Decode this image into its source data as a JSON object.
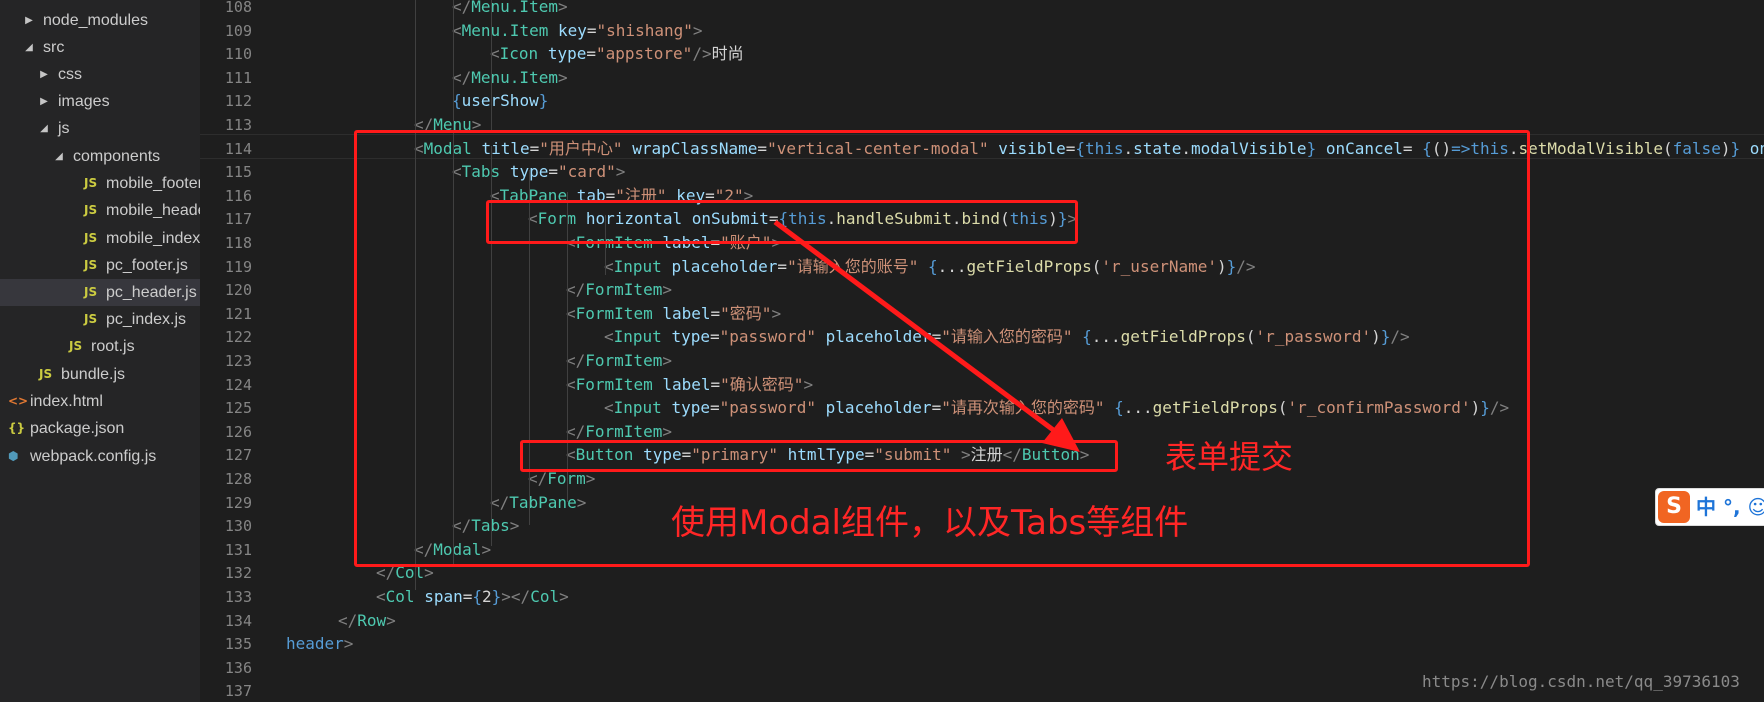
{
  "explorer": {
    "items": [
      {
        "label": "node_modules",
        "type": "folder",
        "expanded": false
      },
      {
        "label": "src",
        "type": "folder",
        "expanded": true
      },
      {
        "label": "css",
        "type": "folder",
        "expanded": false
      },
      {
        "label": "images",
        "type": "folder",
        "expanded": false
      },
      {
        "label": "js",
        "type": "folder",
        "expanded": true
      },
      {
        "label": "components",
        "type": "folder",
        "expanded": true
      },
      {
        "label": "mobile_footer.js",
        "type": "js",
        "icon": "JS"
      },
      {
        "label": "mobile_header.js",
        "type": "js",
        "icon": "JS"
      },
      {
        "label": "mobile_index.js",
        "type": "js",
        "icon": "JS"
      },
      {
        "label": "pc_footer.js",
        "type": "js",
        "icon": "JS"
      },
      {
        "label": "pc_header.js",
        "type": "js",
        "icon": "JS",
        "selected": true
      },
      {
        "label": "pc_index.js",
        "type": "js",
        "icon": "JS"
      },
      {
        "label": "root.js",
        "type": "js",
        "icon": "JS"
      },
      {
        "label": "bundle.js",
        "type": "js",
        "icon": "JS"
      },
      {
        "label": "index.html",
        "type": "html",
        "icon": "<>"
      },
      {
        "label": "package.json",
        "type": "json",
        "icon": "{}"
      },
      {
        "label": "webpack.config.js",
        "type": "config",
        "icon": "⬢"
      }
    ]
  },
  "editor": {
    "line_numbers": [
      "108",
      "109",
      "110",
      "111",
      "112",
      "113",
      "114",
      "115",
      "116",
      "117",
      "118",
      "119",
      "120",
      "121",
      "122",
      "123",
      "124",
      "125",
      "126",
      "127",
      "128",
      "129",
      "130",
      "131",
      "132",
      "133",
      "134",
      "135",
      "136",
      "137"
    ],
    "lines": [
      {
        "tokens": [
          {
            "c": "tb",
            "t": "</"
          },
          {
            "c": "tn",
            "t": "Menu.Item"
          },
          {
            "c": "tb",
            "t": ">"
          }
        ]
      },
      {
        "tokens": [
          {
            "c": "tb",
            "t": "<"
          },
          {
            "c": "tn",
            "t": "Menu.Item"
          },
          {
            "c": "tx",
            "t": " "
          },
          {
            "c": "at",
            "t": "key"
          },
          {
            "c": "tx",
            "t": "="
          },
          {
            "c": "st",
            "t": "\"shishang\""
          },
          {
            "c": "tb",
            "t": ">"
          }
        ]
      },
      {
        "tokens": [
          {
            "c": "tb",
            "t": "<"
          },
          {
            "c": "tn",
            "t": "Icon"
          },
          {
            "c": "tx",
            "t": " "
          },
          {
            "c": "at",
            "t": "type"
          },
          {
            "c": "tx",
            "t": "="
          },
          {
            "c": "st",
            "t": "\"appstore\""
          },
          {
            "c": "tb",
            "t": "/>"
          },
          {
            "c": "tx",
            "t": "时尚"
          }
        ]
      },
      {
        "tokens": [
          {
            "c": "tb",
            "t": "</"
          },
          {
            "c": "tn",
            "t": "Menu.Item"
          },
          {
            "c": "tb",
            "t": ">"
          }
        ]
      },
      {
        "tokens": [
          {
            "c": "kw",
            "t": "{"
          },
          {
            "c": "at",
            "t": "userShow"
          },
          {
            "c": "kw",
            "t": "}"
          }
        ]
      },
      {
        "tokens": [
          {
            "c": "tb",
            "t": "</"
          },
          {
            "c": "tn",
            "t": "Menu"
          },
          {
            "c": "tb",
            "t": ">"
          }
        ]
      },
      {
        "tokens": [
          {
            "c": "tb",
            "t": "<"
          },
          {
            "c": "tn",
            "t": "Modal"
          },
          {
            "c": "tx",
            "t": " "
          },
          {
            "c": "at",
            "t": "title"
          },
          {
            "c": "tx",
            "t": "="
          },
          {
            "c": "st",
            "t": "\"用户中心\""
          },
          {
            "c": "tx",
            "t": " "
          },
          {
            "c": "at",
            "t": "wrapClassName"
          },
          {
            "c": "tx",
            "t": "="
          },
          {
            "c": "st",
            "t": "\"vertical-center-modal\""
          },
          {
            "c": "tx",
            "t": " "
          },
          {
            "c": "at",
            "t": "visible"
          },
          {
            "c": "tx",
            "t": "="
          },
          {
            "c": "kw",
            "t": "{this"
          },
          {
            "c": "tx",
            "t": "."
          },
          {
            "c": "at",
            "t": "state"
          },
          {
            "c": "tx",
            "t": "."
          },
          {
            "c": "at",
            "t": "modalVisible"
          },
          {
            "c": "kw",
            "t": "}"
          },
          {
            "c": "tx",
            "t": " "
          },
          {
            "c": "at",
            "t": "onCancel"
          },
          {
            "c": "tx",
            "t": "= "
          },
          {
            "c": "kw",
            "t": "{"
          },
          {
            "c": "tx",
            "t": "()"
          },
          {
            "c": "kw",
            "t": "=>this"
          },
          {
            "c": "tx",
            "t": "."
          },
          {
            "c": "fn",
            "t": "setModalVisible"
          },
          {
            "c": "tx",
            "t": "("
          },
          {
            "c": "kw",
            "t": "false"
          },
          {
            "c": "tx",
            "t": ")"
          },
          {
            "c": "kw",
            "t": "}"
          },
          {
            "c": "tx",
            "t": " "
          },
          {
            "c": "at",
            "t": "onOk"
          },
          {
            "c": "tx",
            "t": "="
          }
        ]
      },
      {
        "tokens": [
          {
            "c": "tb",
            "t": "<"
          },
          {
            "c": "tn",
            "t": "Tabs"
          },
          {
            "c": "tx",
            "t": " "
          },
          {
            "c": "at",
            "t": "type"
          },
          {
            "c": "tx",
            "t": "="
          },
          {
            "c": "st",
            "t": "\"card\""
          },
          {
            "c": "tb",
            "t": ">"
          }
        ]
      },
      {
        "tokens": [
          {
            "c": "tb",
            "t": "<"
          },
          {
            "c": "tn",
            "t": "TabPane"
          },
          {
            "c": "tx",
            "t": " "
          },
          {
            "c": "at",
            "t": "tab"
          },
          {
            "c": "tx",
            "t": "="
          },
          {
            "c": "st",
            "t": "\"注册\""
          },
          {
            "c": "tx",
            "t": " "
          },
          {
            "c": "at",
            "t": "key"
          },
          {
            "c": "tx",
            "t": "="
          },
          {
            "c": "st",
            "t": "\"2\""
          },
          {
            "c": "tb",
            "t": ">"
          }
        ]
      },
      {
        "tokens": [
          {
            "c": "tb",
            "t": "<"
          },
          {
            "c": "tn",
            "t": "Form"
          },
          {
            "c": "tx",
            "t": " "
          },
          {
            "c": "at",
            "t": "horizontal"
          },
          {
            "c": "tx",
            "t": " "
          },
          {
            "c": "at",
            "t": "onSubmit"
          },
          {
            "c": "tx",
            "t": "="
          },
          {
            "c": "kw",
            "t": "{this"
          },
          {
            "c": "tx",
            "t": "."
          },
          {
            "c": "fn",
            "t": "handleSubmit"
          },
          {
            "c": "tx",
            "t": "."
          },
          {
            "c": "fn",
            "t": "bind"
          },
          {
            "c": "tx",
            "t": "("
          },
          {
            "c": "kw",
            "t": "this"
          },
          {
            "c": "tx",
            "t": ")"
          },
          {
            "c": "kw",
            "t": "}"
          },
          {
            "c": "tb",
            "t": ">"
          }
        ]
      },
      {
        "tokens": [
          {
            "c": "tb",
            "t": "<"
          },
          {
            "c": "tn",
            "t": "FormItem"
          },
          {
            "c": "tx",
            "t": " "
          },
          {
            "c": "at",
            "t": "label"
          },
          {
            "c": "tx",
            "t": "="
          },
          {
            "c": "st",
            "t": "\"账户\""
          },
          {
            "c": "tb",
            "t": ">"
          }
        ]
      },
      {
        "tokens": [
          {
            "c": "tb",
            "t": "<"
          },
          {
            "c": "tn",
            "t": "Input"
          },
          {
            "c": "tx",
            "t": " "
          },
          {
            "c": "at",
            "t": "placeholder"
          },
          {
            "c": "tx",
            "t": "="
          },
          {
            "c": "st",
            "t": "\"请输入您的账号\""
          },
          {
            "c": "tx",
            "t": " "
          },
          {
            "c": "kw",
            "t": "{"
          },
          {
            "c": "tx",
            "t": "..."
          },
          {
            "c": "fn",
            "t": "getFieldProps"
          },
          {
            "c": "tx",
            "t": "("
          },
          {
            "c": "st",
            "t": "'r_userName'"
          },
          {
            "c": "tx",
            "t": ")"
          },
          {
            "c": "kw",
            "t": "}"
          },
          {
            "c": "tb",
            "t": "/>"
          }
        ]
      },
      {
        "tokens": [
          {
            "c": "tb",
            "t": "</"
          },
          {
            "c": "tn",
            "t": "FormItem"
          },
          {
            "c": "tb",
            "t": ">"
          }
        ]
      },
      {
        "tokens": [
          {
            "c": "tb",
            "t": "<"
          },
          {
            "c": "tn",
            "t": "FormItem"
          },
          {
            "c": "tx",
            "t": " "
          },
          {
            "c": "at",
            "t": "label"
          },
          {
            "c": "tx",
            "t": "="
          },
          {
            "c": "st",
            "t": "\"密码\""
          },
          {
            "c": "tb",
            "t": ">"
          }
        ]
      },
      {
        "tokens": [
          {
            "c": "tb",
            "t": "<"
          },
          {
            "c": "tn",
            "t": "Input"
          },
          {
            "c": "tx",
            "t": " "
          },
          {
            "c": "at",
            "t": "type"
          },
          {
            "c": "tx",
            "t": "="
          },
          {
            "c": "st",
            "t": "\"password\""
          },
          {
            "c": "tx",
            "t": " "
          },
          {
            "c": "at",
            "t": "placeholder"
          },
          {
            "c": "tx",
            "t": "="
          },
          {
            "c": "st",
            "t": "\"请输入您的密码\""
          },
          {
            "c": "tx",
            "t": " "
          },
          {
            "c": "kw",
            "t": "{"
          },
          {
            "c": "tx",
            "t": "..."
          },
          {
            "c": "fn",
            "t": "getFieldProps"
          },
          {
            "c": "tx",
            "t": "("
          },
          {
            "c": "st",
            "t": "'r_password'"
          },
          {
            "c": "tx",
            "t": ")"
          },
          {
            "c": "kw",
            "t": "}"
          },
          {
            "c": "tb",
            "t": "/>"
          }
        ]
      },
      {
        "tokens": [
          {
            "c": "tb",
            "t": "</"
          },
          {
            "c": "tn",
            "t": "FormItem"
          },
          {
            "c": "tb",
            "t": ">"
          }
        ]
      },
      {
        "tokens": [
          {
            "c": "tb",
            "t": "<"
          },
          {
            "c": "tn",
            "t": "FormItem"
          },
          {
            "c": "tx",
            "t": " "
          },
          {
            "c": "at",
            "t": "label"
          },
          {
            "c": "tx",
            "t": "="
          },
          {
            "c": "st",
            "t": "\"确认密码\""
          },
          {
            "c": "tb",
            "t": ">"
          }
        ]
      },
      {
        "tokens": [
          {
            "c": "tb",
            "t": "<"
          },
          {
            "c": "tn",
            "t": "Input"
          },
          {
            "c": "tx",
            "t": " "
          },
          {
            "c": "at",
            "t": "type"
          },
          {
            "c": "tx",
            "t": "="
          },
          {
            "c": "st",
            "t": "\"password\""
          },
          {
            "c": "tx",
            "t": " "
          },
          {
            "c": "at",
            "t": "placeholder"
          },
          {
            "c": "tx",
            "t": "="
          },
          {
            "c": "st",
            "t": "\"请再次输入您的密码\""
          },
          {
            "c": "tx",
            "t": " "
          },
          {
            "c": "kw",
            "t": "{"
          },
          {
            "c": "tx",
            "t": "..."
          },
          {
            "c": "fn",
            "t": "getFieldProps"
          },
          {
            "c": "tx",
            "t": "("
          },
          {
            "c": "st",
            "t": "'r_confirmPassword'"
          },
          {
            "c": "tx",
            "t": ")"
          },
          {
            "c": "kw",
            "t": "}"
          },
          {
            "c": "tb",
            "t": "/>"
          }
        ]
      },
      {
        "tokens": [
          {
            "c": "tb",
            "t": "</"
          },
          {
            "c": "tn",
            "t": "FormItem"
          },
          {
            "c": "tb",
            "t": ">"
          }
        ]
      },
      {
        "tokens": [
          {
            "c": "tb",
            "t": "<"
          },
          {
            "c": "tn",
            "t": "Button"
          },
          {
            "c": "tx",
            "t": " "
          },
          {
            "c": "at",
            "t": "type"
          },
          {
            "c": "tx",
            "t": "="
          },
          {
            "c": "st",
            "t": "\"primary\""
          },
          {
            "c": "tx",
            "t": " "
          },
          {
            "c": "at",
            "t": "htmlType"
          },
          {
            "c": "tx",
            "t": "="
          },
          {
            "c": "st",
            "t": "\"submit\""
          },
          {
            "c": "tx",
            "t": " "
          },
          {
            "c": "tb",
            "t": ">"
          },
          {
            "c": "tx",
            "t": "注册"
          },
          {
            "c": "tb",
            "t": "</"
          },
          {
            "c": "tn",
            "t": "Button"
          },
          {
            "c": "tb",
            "t": ">"
          }
        ]
      },
      {
        "tokens": [
          {
            "c": "tb",
            "t": "</"
          },
          {
            "c": "tn",
            "t": "Form"
          },
          {
            "c": "tb",
            "t": ">"
          }
        ]
      },
      {
        "tokens": [
          {
            "c": "tb",
            "t": "</"
          },
          {
            "c": "tn",
            "t": "TabPane"
          },
          {
            "c": "tb",
            "t": ">"
          }
        ]
      },
      {
        "tokens": [
          {
            "c": "tb",
            "t": "</"
          },
          {
            "c": "tn",
            "t": "Tabs"
          },
          {
            "c": "tb",
            "t": ">"
          }
        ]
      },
      {
        "tokens": [
          {
            "c": "tb",
            "t": "</"
          },
          {
            "c": "tn",
            "t": "Modal"
          },
          {
            "c": "tb",
            "t": ">"
          }
        ]
      },
      {
        "tokens": [
          {
            "c": "tb",
            "t": "</"
          },
          {
            "c": "tn",
            "t": "Col"
          },
          {
            "c": "tb",
            "t": ">"
          }
        ]
      },
      {
        "tokens": [
          {
            "c": "tb",
            "t": "<"
          },
          {
            "c": "tn",
            "t": "Col"
          },
          {
            "c": "tx",
            "t": " "
          },
          {
            "c": "at",
            "t": "span"
          },
          {
            "c": "tx",
            "t": "="
          },
          {
            "c": "kw",
            "t": "{"
          },
          {
            "c": "tx",
            "t": "2"
          },
          {
            "c": "kw",
            "t": "}"
          },
          {
            "c": "tb",
            "t": "></"
          },
          {
            "c": "tn",
            "t": "Col"
          },
          {
            "c": "tb",
            "t": ">"
          }
        ]
      },
      {
        "tokens": [
          {
            "c": "tb",
            "t": "</"
          },
          {
            "c": "tn",
            "t": "Row"
          },
          {
            "c": "tb",
            "t": ">"
          }
        ]
      },
      {
        "tokens": [
          {
            "c": "kw",
            "t": "header"
          },
          {
            "c": "tb",
            "t": ">"
          }
        ]
      },
      {
        "tokens": []
      },
      {
        "tokens": []
      }
    ]
  },
  "annotations": {
    "submit_label": "表单提交",
    "components_label": "使用Modal组件，以及Tabs等组件",
    "color": "#ff1a1a"
  },
  "ime_toolbar": {
    "logo": "S",
    "text": "中 °, ☺"
  },
  "watermark": "https://blog.csdn.net/qq_39736103"
}
